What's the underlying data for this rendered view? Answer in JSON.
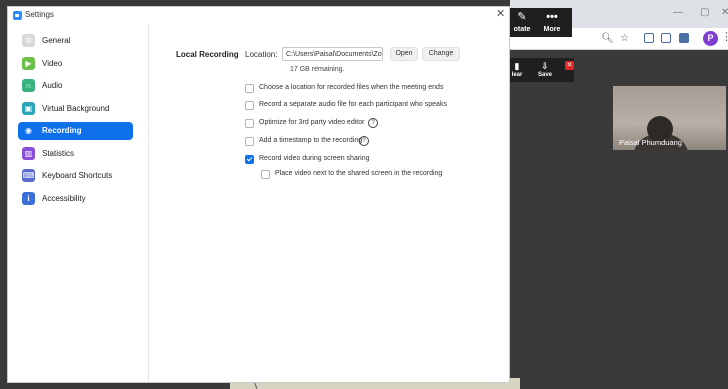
{
  "window": {
    "title": "Settings"
  },
  "sidebar": {
    "items": [
      {
        "label": "General",
        "icon": "gear-icon",
        "color": "#d9d9d9"
      },
      {
        "label": "Video",
        "icon": "video-camera-icon",
        "color": "#6cc04a"
      },
      {
        "label": "Audio",
        "icon": "headphones-icon",
        "color": "#36b37e"
      },
      {
        "label": "Virtual Background",
        "icon": "virtual-background-icon",
        "color": "#2aa6b8"
      },
      {
        "label": "Recording",
        "icon": "recording-icon",
        "color": "#0e71eb"
      },
      {
        "label": "Statistics",
        "icon": "statistics-icon",
        "color": "#8a4fd8"
      },
      {
        "label": "Keyboard Shortcuts",
        "icon": "keyboard-icon",
        "color": "#5a6acf"
      },
      {
        "label": "Accessibility",
        "icon": "accessibility-icon",
        "color": "#3a6fd8"
      }
    ],
    "active_index": 4
  },
  "recording": {
    "section_title": "Local Recording",
    "location_label": "Location:",
    "location_value": "C:\\Users\\Paisal\\Documents\\Zoom",
    "open_label": "Open",
    "change_label": "Change",
    "remaining": "17 GB remaining.",
    "options": [
      {
        "label": "Choose a location for recorded files when the meeting ends",
        "checked": false,
        "help": false
      },
      {
        "label": "Record a separate audio file for each participant who speaks",
        "checked": false,
        "help": false
      },
      {
        "label": "Optimize for 3rd party video editor",
        "checked": false,
        "help": true
      },
      {
        "label": "Add a timestamp to the recording",
        "checked": false,
        "help": true
      },
      {
        "label": "Record video during screen sharing",
        "checked": true,
        "help": false
      },
      {
        "label": "Place video next to the shared screen in the recording",
        "checked": false,
        "help": false
      }
    ]
  },
  "meeting": {
    "toolbar": {
      "rotate_label": "otate",
      "more_label": "More"
    },
    "annotate": {
      "clear_label": "lear",
      "save_label": "Save"
    },
    "participant_name": "Paisal Phumduang"
  },
  "colors": {
    "accent": "#0e71eb",
    "toolbar_bg": "#1f1f1f"
  }
}
